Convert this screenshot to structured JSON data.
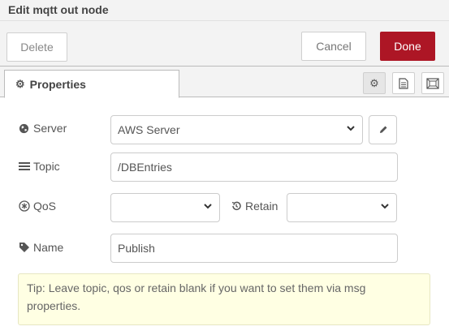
{
  "window": {
    "title": "Edit mqtt out node"
  },
  "toolbar": {
    "delete_label": "Delete",
    "cancel_label": "Cancel",
    "done_label": "Done"
  },
  "tabs": {
    "properties_label": "Properties",
    "icons": [
      "gear-icon",
      "document-icon",
      "frame-icon"
    ]
  },
  "form": {
    "server": {
      "label": "Server",
      "value": "AWS Server",
      "icon": "globe-icon"
    },
    "topic": {
      "label": "Topic",
      "value": "/DBEntries",
      "icon": "list-icon"
    },
    "qos": {
      "label": "QoS",
      "value": "",
      "icon": "asterisk-icon"
    },
    "retain": {
      "label": "Retain",
      "value": "",
      "icon": "history-icon"
    },
    "name": {
      "label": "Name",
      "value": "Publish",
      "icon": "tag-icon"
    }
  },
  "tip": {
    "text": "Tip: Leave topic, qos or retain blank if you want to set them via msg properties."
  },
  "colors": {
    "primary": "#ad1625",
    "tip_bg": "#ffffe3"
  }
}
